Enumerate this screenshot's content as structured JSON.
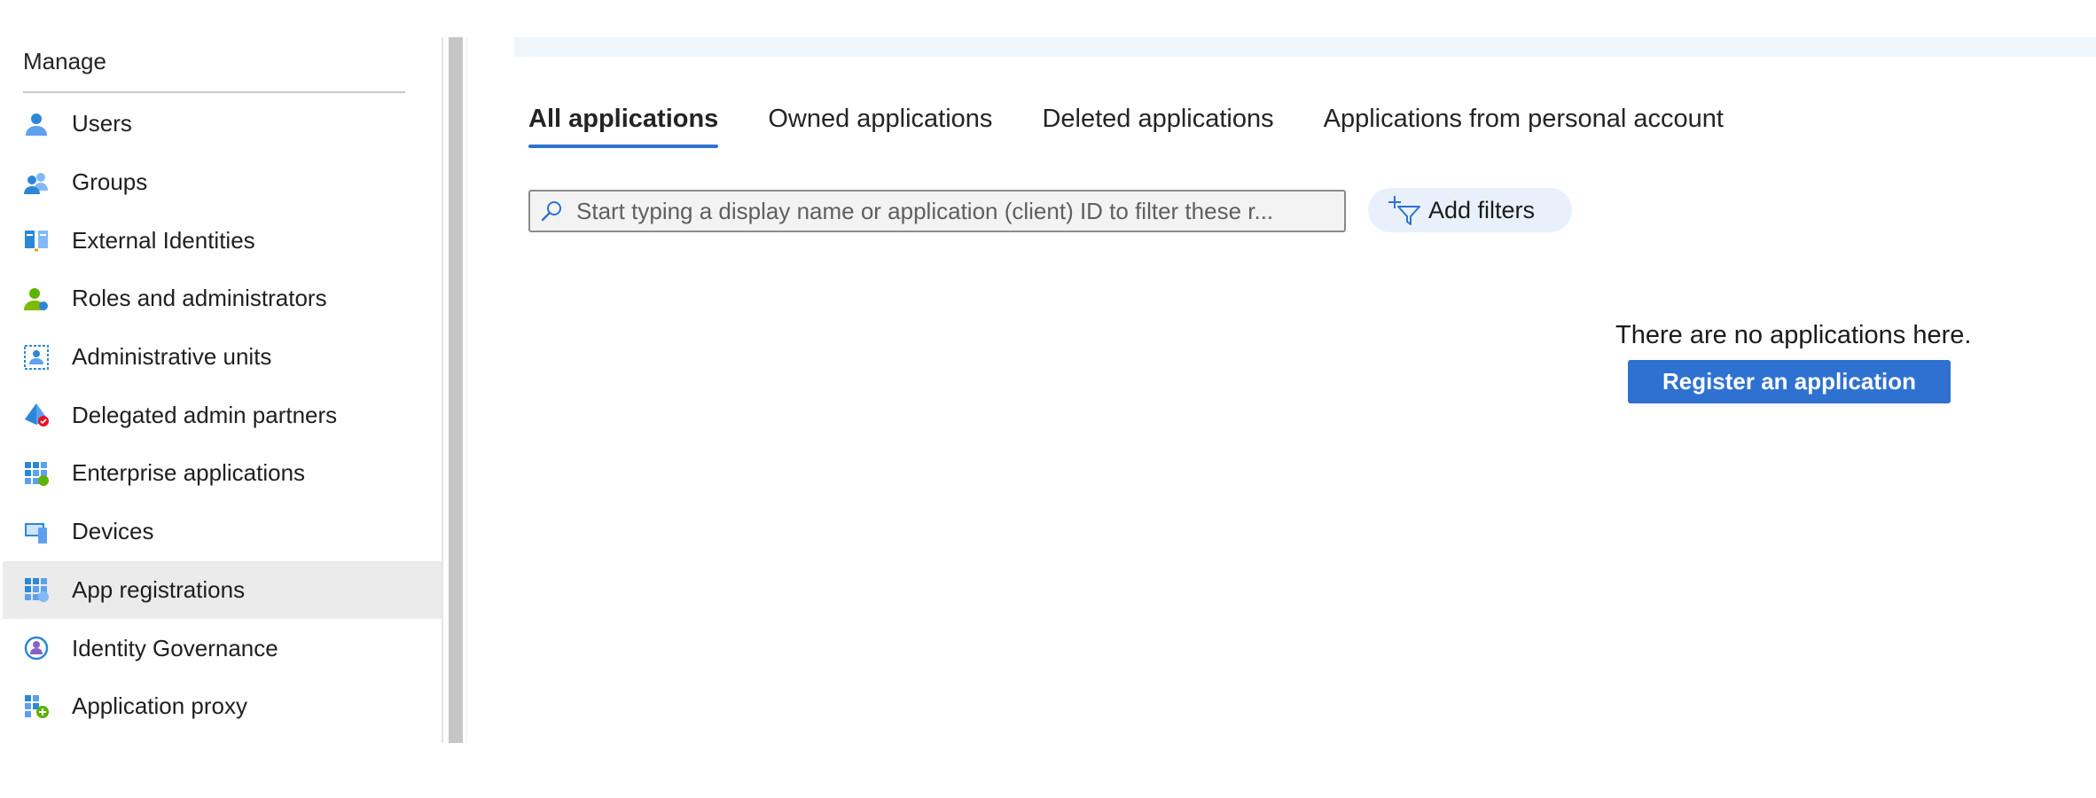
{
  "sidebar": {
    "header": "Manage",
    "items": [
      {
        "label": "Users",
        "icon": "user-icon"
      },
      {
        "label": "Groups",
        "icon": "groups-icon"
      },
      {
        "label": "External Identities",
        "icon": "external-identities-icon"
      },
      {
        "label": "Roles and administrators",
        "icon": "roles-icon"
      },
      {
        "label": "Administrative units",
        "icon": "administrative-units-icon"
      },
      {
        "label": "Delegated admin partners",
        "icon": "delegated-admin-icon"
      },
      {
        "label": "Enterprise applications",
        "icon": "enterprise-apps-icon"
      },
      {
        "label": "Devices",
        "icon": "devices-icon"
      },
      {
        "label": "App registrations",
        "icon": "app-registrations-icon",
        "selected": true
      },
      {
        "label": "Identity Governance",
        "icon": "identity-governance-icon"
      },
      {
        "label": "Application proxy",
        "icon": "application-proxy-icon"
      }
    ]
  },
  "main": {
    "tabs": [
      {
        "label": "All applications",
        "active": true
      },
      {
        "label": "Owned applications",
        "active": false
      },
      {
        "label": "Deleted applications",
        "active": false
      },
      {
        "label": "Applications from personal account",
        "active": false
      }
    ],
    "search": {
      "placeholder": "Start typing a display name or application (client) ID to filter these r...",
      "value": ""
    },
    "filter_button": {
      "label": "Add filters",
      "icon": "add-filter-icon"
    },
    "empty_state": {
      "message": "There are no applications here.",
      "button_label": "Register an application"
    }
  },
  "colors": {
    "accent": "#2f71d0",
    "selected_bg": "#ebebeb",
    "filter_bg": "#e8f1fb",
    "top_strip": "#eff6fc"
  }
}
